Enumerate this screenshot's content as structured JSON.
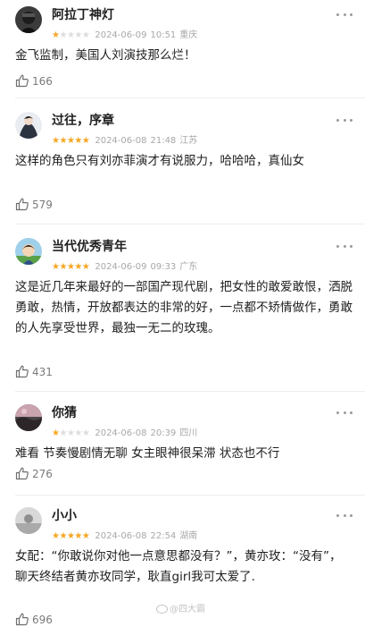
{
  "reviews": [
    {
      "username": "阿拉丁神灯",
      "rating": 1,
      "date": "2024-06-09",
      "time": "10:51",
      "location": "重庆",
      "content": "金飞监制，美国人刘演技那么烂！",
      "likes": "166"
    },
    {
      "username": "过往，序章",
      "rating": 5,
      "date": "2024-06-08",
      "time": "21:48",
      "location": "江苏",
      "content": "这样的角色只有刘亦菲演才有说服力，哈哈哈，真仙女",
      "likes": "579"
    },
    {
      "username": "当代优秀青年",
      "rating": 5,
      "date": "2024-06-09",
      "time": "09:33",
      "location": "广东",
      "content": "这是近几年来最好的一部国产现代剧，把女性的敢爱敢恨，洒脱勇敢，热情，开放都表达的非常的好，一点都不矫情做作，勇敢的人先享受世界，最独一无二的玫瑰。",
      "likes": "431"
    },
    {
      "username": "你猜",
      "rating": 1,
      "date": "2024-06-08",
      "time": "20:39",
      "location": "四川",
      "content": "难看 节奏慢剧情无聊 女主眼神很呆滞 状态也不行",
      "likes": "276"
    },
    {
      "username": "小小",
      "rating": 5,
      "date": "2024-06-08",
      "time": "22:54",
      "location": "湖南",
      "content": "女配：“你敢说你对他一点意思都没有？”，黄亦玫：“没有”，聊天终结者黄亦玫同学，耿直girl我可太爱了.",
      "likes": "696"
    }
  ],
  "watermark": "@四大霸",
  "colors": {
    "star_on": "#f5a623",
    "star_off": "#dcdcdc",
    "meta": "#a8a8a8"
  },
  "icons": {
    "like": "thumbs-up-icon",
    "more": "more-dots-icon"
  }
}
